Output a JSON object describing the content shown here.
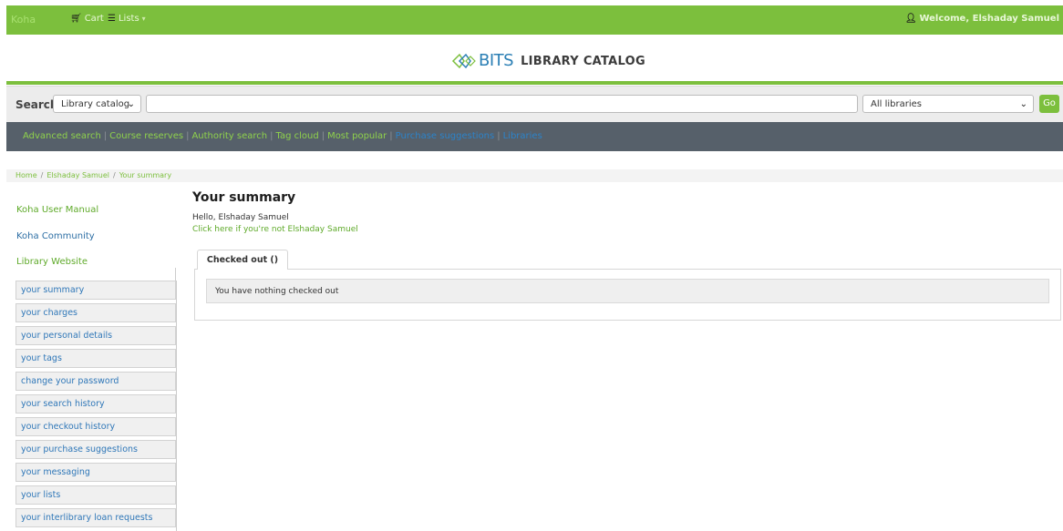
{
  "topbar": {
    "brand": "Koha",
    "cart_label": "Cart",
    "lists_label": "Lists",
    "welcome": "Welcome, Elshaday Samuel"
  },
  "header": {
    "logo_text": "BITS",
    "logo_tagline": "LIBRARY CATALOG"
  },
  "search": {
    "label": "Search",
    "scope_value": "Library catalog",
    "query_value": "",
    "library_value": "All libraries",
    "go_label": "Go"
  },
  "moresearches": [
    {
      "label": "Advanced search"
    },
    {
      "label": "Course reserves"
    },
    {
      "label": "Authority search"
    },
    {
      "label": "Tag cloud"
    },
    {
      "label": "Most popular"
    },
    {
      "label": "Purchase suggestions"
    },
    {
      "label": "Libraries"
    }
  ],
  "breadcrumb": [
    "Home",
    "Elshaday Samuel",
    "Your summary"
  ],
  "leftlinks": [
    "Koha User Manual",
    "Koha Community",
    "Library Website"
  ],
  "usermenu": [
    "your summary",
    "your charges",
    "your personal details",
    "your tags",
    "change your password",
    "your search history",
    "your checkout history",
    "your purchase suggestions",
    "your messaging",
    "your lists",
    "your interlibrary loan requests"
  ],
  "main": {
    "title": "Your summary",
    "hello": "Hello, Elshaday Samuel",
    "not_you": "Click here if you're not Elshaday Samuel",
    "tab_label": "Checked out ()",
    "empty_message": "You have nothing checked out"
  },
  "colors": {
    "accent": "#7cbf3d",
    "nav_bg": "#56606a",
    "link": "#2c6ea4"
  }
}
